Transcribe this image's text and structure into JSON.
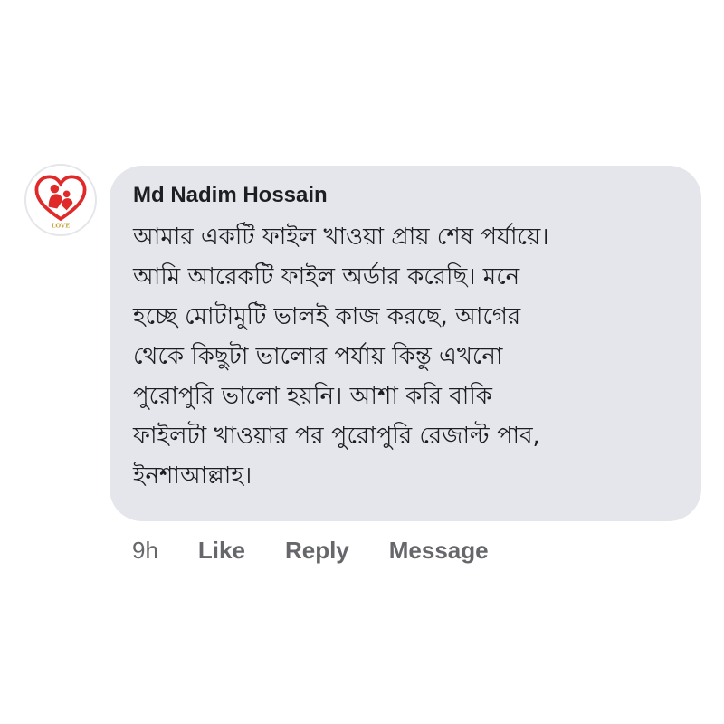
{
  "comment": {
    "author": "Md Nadim Hossain",
    "lines": [
      "আমার একটি ফাইল খাওয়া প্রায় শেষ পর্যায়ে।",
      "আমি আরেকটি ফাইল অর্ডার করেছি। মনে",
      "হচ্ছে মোটামুটি ভালই কাজ করছে, আগের",
      "থেকে কিছুটা ভালোর পর্যায় কিন্তু এখনো",
      "পুরোপুরি ভালো হয়নি। আশা করি বাকি",
      "ফাইলটা খাওয়ার পর পুরোপুরি রেজাল্ট পাব,",
      "ইনশাআল্লাহ।"
    ],
    "time": "9h",
    "actions": {
      "like": "Like",
      "reply": "Reply",
      "message": "Message"
    }
  },
  "avatar": {
    "icon": "heart-family-logo-icon",
    "logo_text": "LOVE",
    "colors": {
      "heart": "#e02a2a",
      "text": "#c9a23c"
    }
  },
  "colors": {
    "bubble": "#e4e6eb",
    "text": "#1c1e21",
    "meta": "#65676b"
  }
}
